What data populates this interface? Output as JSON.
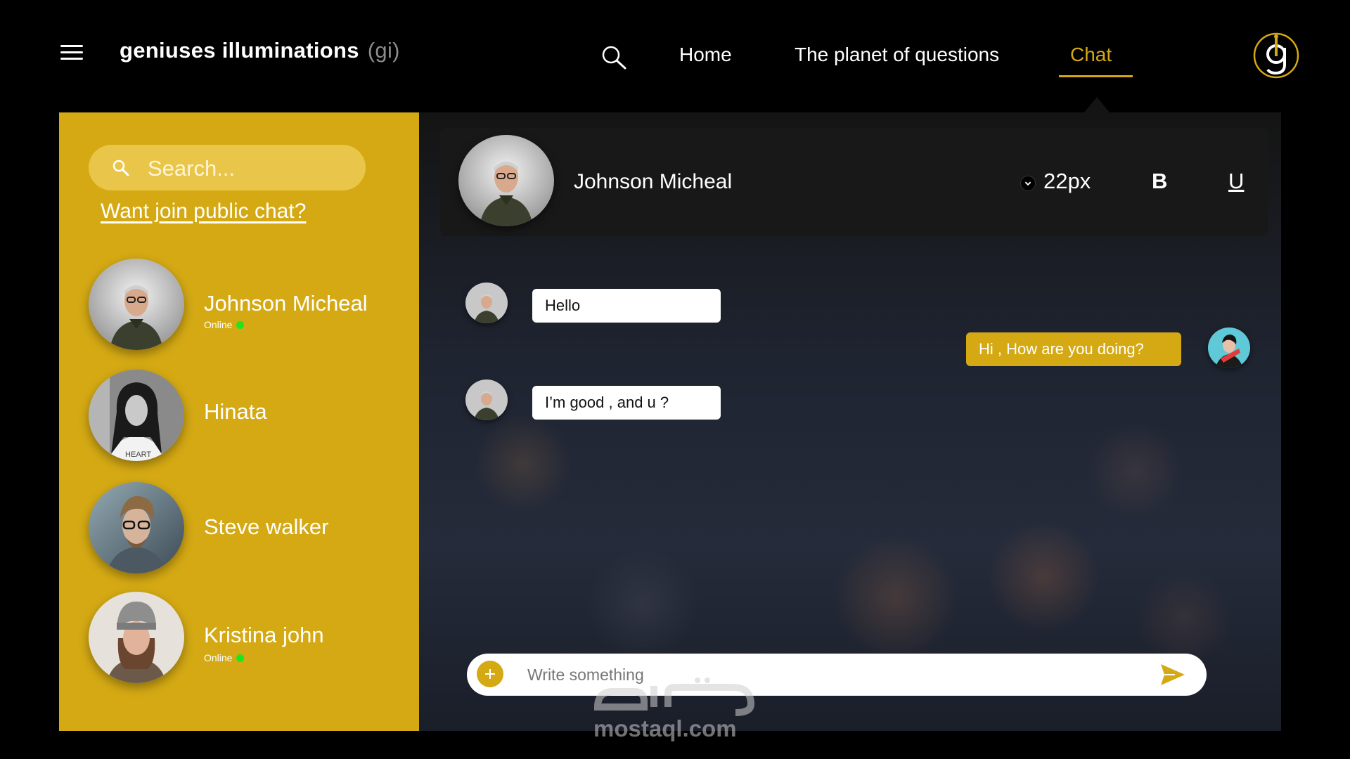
{
  "app": {
    "brand": "geniuses illuminations",
    "brand_abbr": "(gi)"
  },
  "nav": {
    "home": "Home",
    "planet": "The planet of questions",
    "chat": "Chat",
    "active": "Chat"
  },
  "icons": {
    "menu": "hamburger-icon",
    "nav_search": "search-icon",
    "logo": "gi-logo",
    "sidebar_search": "search-icon",
    "font_size_dropdown": "chevron-down-icon",
    "attach": "plus-icon",
    "send": "send-icon"
  },
  "colors": {
    "accent": "#d4a914",
    "sidebar_bg": "#d4a914",
    "search_bg": "#e9c649",
    "online": "#1ee61e",
    "header_bg": "#181818"
  },
  "sidebar": {
    "search_placeholder": "Search...",
    "public_chat_link": "Want join public chat?",
    "contacts": [
      {
        "name": "Johnson Micheal",
        "status": "Online",
        "online": true
      },
      {
        "name": "Hinata",
        "status": "",
        "online": false
      },
      {
        "name": "Steve walker",
        "status": "",
        "online": false
      },
      {
        "name": "Kristina john",
        "status": "Online",
        "online": true
      }
    ]
  },
  "chat": {
    "header": {
      "name": "Johnson Micheal",
      "font_size": "22px",
      "bold_label": "B",
      "underline_label": "U"
    },
    "messages": [
      {
        "from": "them",
        "text": "Hello"
      },
      {
        "from": "me",
        "text": "Hi , How are you doing?"
      },
      {
        "from": "them",
        "text": "I’m good , and u ?"
      }
    ],
    "composer": {
      "placeholder": "Write something"
    }
  },
  "watermark": {
    "text": "mostaql.com"
  }
}
